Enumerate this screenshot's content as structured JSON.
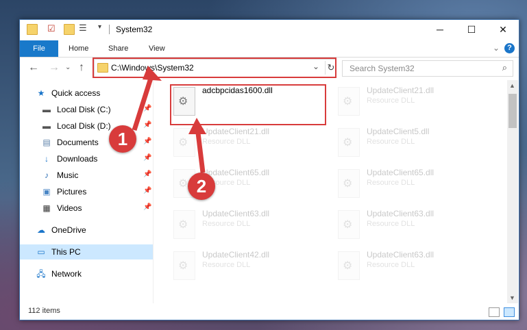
{
  "window": {
    "title": "System32"
  },
  "ribbon": {
    "tabs": [
      "File",
      "Home",
      "Share",
      "View"
    ]
  },
  "nav": {
    "address_value": "C:\\Windows\\System32",
    "search_placeholder": "Search System32"
  },
  "sidebar": {
    "items": [
      {
        "label": "Quick access",
        "icon": "star-icon"
      },
      {
        "label": "Local Disk (C:)",
        "icon": "drive-icon"
      },
      {
        "label": "Local Disk (D:)",
        "icon": "drive-icon"
      },
      {
        "label": "Documents",
        "icon": "documents-icon"
      },
      {
        "label": "Downloads",
        "icon": "download-icon"
      },
      {
        "label": "Music",
        "icon": "music-icon"
      },
      {
        "label": "Pictures",
        "icon": "pictures-icon"
      },
      {
        "label": "Videos",
        "icon": "videos-icon"
      },
      {
        "label": "OneDrive",
        "icon": "cloud-icon"
      },
      {
        "label": "This PC",
        "icon": "computer-icon"
      },
      {
        "label": "Network",
        "icon": "network-icon"
      }
    ]
  },
  "files": {
    "main": {
      "name": "adcbpcidas1600.dll"
    },
    "ghost_items": [
      {
        "name": "UpdateClient21.dll",
        "type": "Resource DLL"
      },
      {
        "name": "UpdateClient21.dll",
        "type": "Resource DLL"
      },
      {
        "name": "UpdateClient5.dll",
        "type": "Resource DLL"
      },
      {
        "name": "UpdateClient65.dll",
        "type": "Resource DLL"
      },
      {
        "name": "UpdateClient65.dll",
        "type": "Resource DLL"
      },
      {
        "name": "UpdateClient63.dll",
        "type": "Resource DLL"
      },
      {
        "name": "UpdateClient63.dll",
        "type": "Resource DLL"
      },
      {
        "name": "UpdateClient42.dll",
        "type": "Resource DLL"
      },
      {
        "name": "UpdateClient63.dll",
        "type": "Resource DLL"
      }
    ]
  },
  "status": {
    "item_count": "112 items"
  },
  "callouts": [
    "1",
    "2"
  ],
  "colors": {
    "accent": "#1979ca",
    "highlight": "#d83b3b",
    "selected": "#cce8ff"
  }
}
